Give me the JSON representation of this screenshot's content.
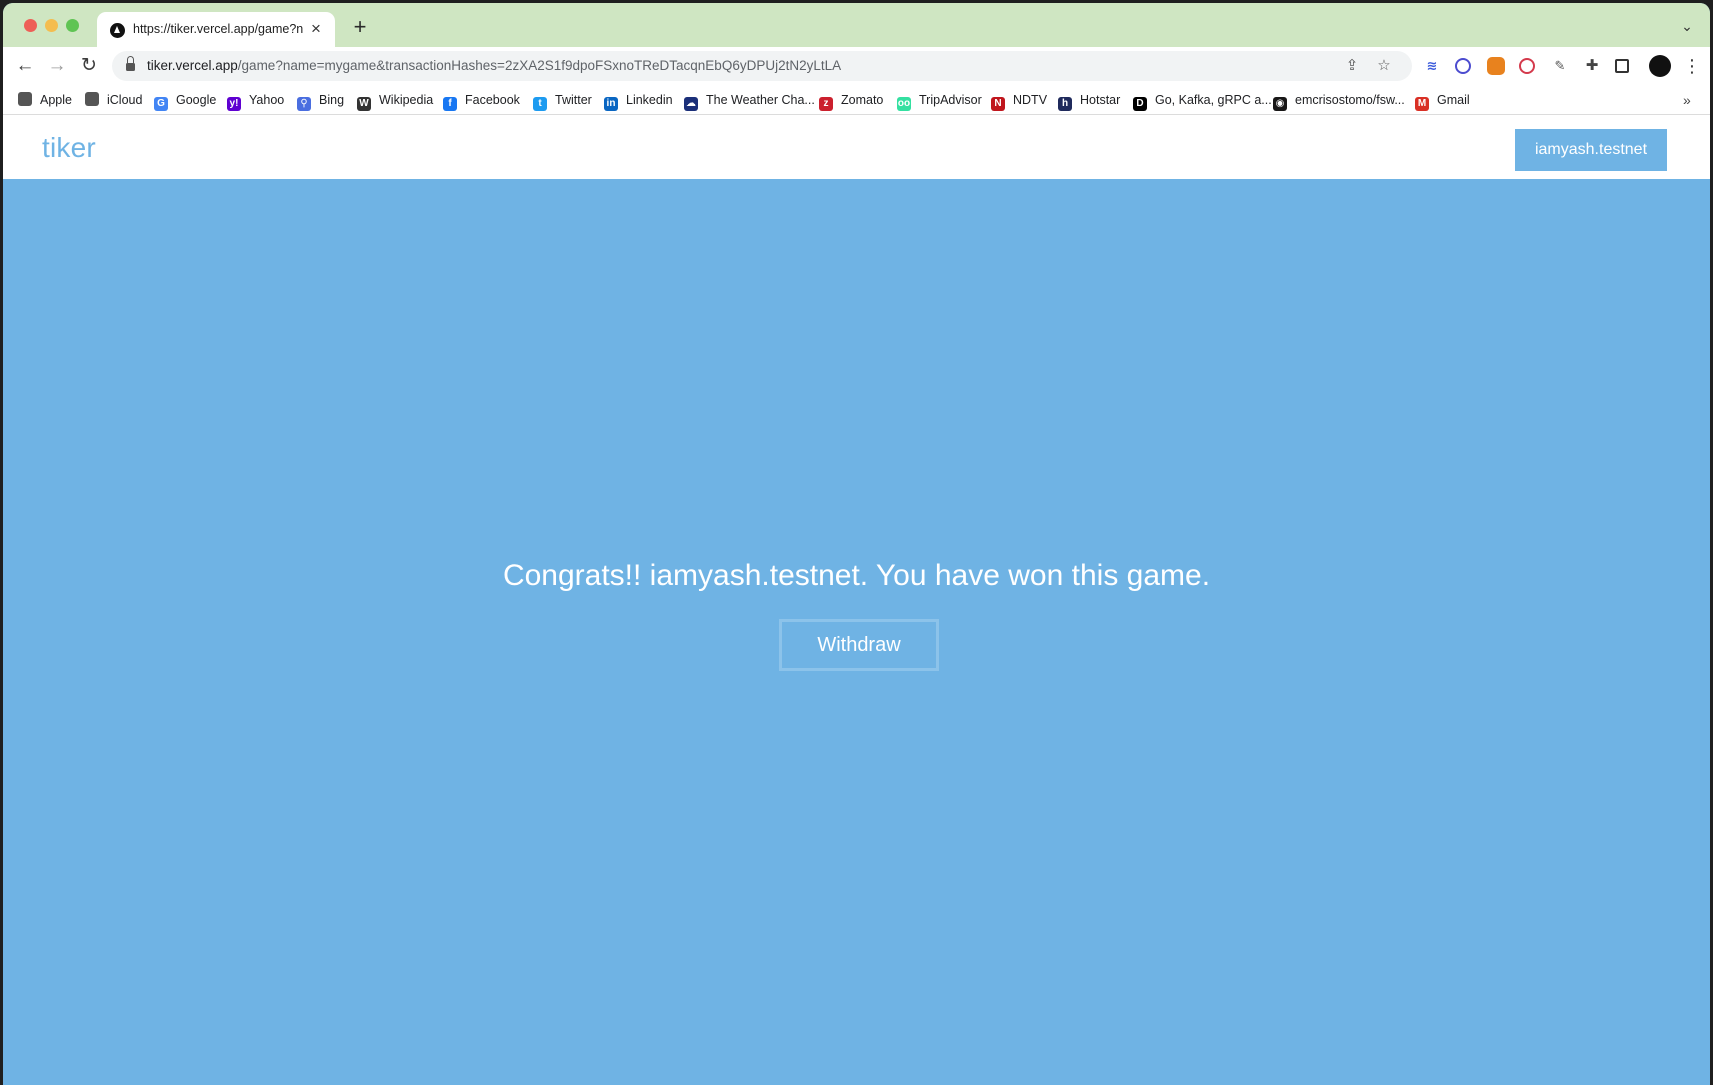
{
  "browser": {
    "tab": {
      "title": "https://tiker.vercel.app/game?n",
      "close_glyph": "×"
    },
    "new_tab_glyph": "+",
    "tab_search_glyph": "⌄",
    "nav": {
      "back_glyph": "←",
      "forward_glyph": "→",
      "reload_glyph": "↻"
    },
    "url": {
      "host": "tiker.vercel.app",
      "path": "/game?name=mygame&transactionHashes=2zXA2S1f9dpoFSxnoTReDTacqnEbQ6yDPUj2tN2yLtLA"
    },
    "omnibox_icons": {
      "share_glyph": "⇪",
      "star_glyph": "☆"
    },
    "menu_glyph": "⋮",
    "bookmarks": [
      {
        "label": "Apple",
        "icon": "apple-icon",
        "glyph": "",
        "color": "#555555"
      },
      {
        "label": "iCloud",
        "icon": "apple-icon",
        "glyph": "",
        "color": "#555555"
      },
      {
        "label": "Google",
        "icon": "google-icon",
        "glyph": "G",
        "color": "#4285f4"
      },
      {
        "label": "Yahoo",
        "icon": "yahoo-icon",
        "glyph": "y!",
        "color": "#5f01d1"
      },
      {
        "label": "Bing",
        "icon": "bing-search-icon",
        "glyph": "⚲",
        "color": "#4a6ee0"
      },
      {
        "label": "Wikipedia",
        "icon": "wikipedia-icon",
        "glyph": "W",
        "color": "#333333"
      },
      {
        "label": "Facebook",
        "icon": "facebook-icon",
        "glyph": "f",
        "color": "#1877f2"
      },
      {
        "label": "Twitter",
        "icon": "twitter-icon",
        "glyph": "t",
        "color": "#1d9bf0"
      },
      {
        "label": "Linkedin",
        "icon": "linkedin-icon",
        "glyph": "in",
        "color": "#0a66c2"
      },
      {
        "label": "The Weather Cha...",
        "icon": "weather-channel-icon",
        "glyph": "☁",
        "color": "#1b2f79"
      },
      {
        "label": "Zomato",
        "icon": "zomato-icon",
        "glyph": "z",
        "color": "#cb202d"
      },
      {
        "label": "TripAdvisor",
        "icon": "tripadvisor-icon",
        "glyph": "oo",
        "color": "#34e0a1"
      },
      {
        "label": "NDTV",
        "icon": "ndtv-icon",
        "glyph": "N",
        "color": "#c0161d"
      },
      {
        "label": "Hotstar",
        "icon": "hotstar-icon",
        "glyph": "h",
        "color": "#1f2a5c"
      },
      {
        "label": "Go, Kafka, gRPC a...",
        "icon": "dev-icon",
        "glyph": "D",
        "color": "#000000"
      },
      {
        "label": "emcrisostomo/fsw...",
        "icon": "github-icon",
        "glyph": "◉",
        "color": "#181717"
      },
      {
        "label": "Gmail",
        "icon": "gmail-icon",
        "glyph": "M",
        "color": "#d93025"
      }
    ],
    "bookmarks_more_glyph": "»"
  },
  "site": {
    "logo": "tiker",
    "account_label": "iamyash.testnet",
    "message": "Congrats!! iamyash.testnet. You have won this game.",
    "withdraw_label": "Withdraw"
  },
  "colors": {
    "brand": "#6fb3e4",
    "tab_strip": "#cfe6c2"
  }
}
